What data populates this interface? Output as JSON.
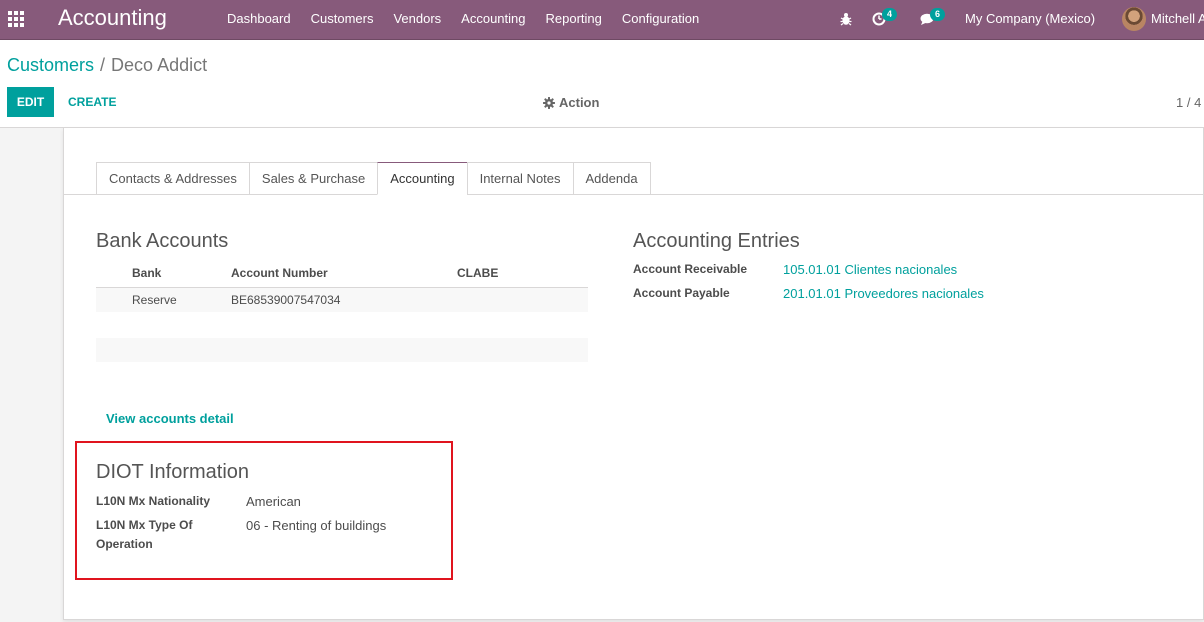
{
  "navbar": {
    "app_title": "Accounting",
    "menu": [
      "Dashboard",
      "Customers",
      "Vendors",
      "Accounting",
      "Reporting",
      "Configuration"
    ],
    "activity_count": "4",
    "message_count": "6",
    "company": "My Company (Mexico)",
    "user": "Mitchell Admin",
    "icons": [
      "apps-icon",
      "bug-icon",
      "clock-icon",
      "chat-icon",
      "avatar"
    ]
  },
  "control_panel": {
    "breadcrumb_parent": "Customers",
    "breadcrumb_separator": "/",
    "breadcrumb_current": "Deco Addict",
    "edit_label": "EDIT",
    "create_label": "CREATE",
    "action_label": "Action",
    "pager": "1 / 4"
  },
  "tabs": [
    "Contacts & Addresses",
    "Sales & Purchase",
    "Accounting",
    "Internal Notes",
    "Addenda"
  ],
  "active_tab": "Accounting",
  "bank_accounts": {
    "title": "Bank Accounts",
    "columns": [
      "Bank",
      "Account Number",
      "CLABE"
    ],
    "rows": [
      {
        "bank": "Reserve",
        "account_number": "BE68539007547034",
        "clabe": ""
      }
    ],
    "view_details": "View accounts detail"
  },
  "accounting_entries": {
    "title": "Accounting Entries",
    "receivable_label": "Account Receivable",
    "receivable_value": "105.01.01 Clientes nacionales",
    "payable_label": "Account Payable",
    "payable_value": "201.01.01 Proveedores nacionales"
  },
  "diot": {
    "title": "DIOT Information",
    "nationality_label": "L10N Mx Nationality",
    "nationality_value": "American",
    "operation_label_line1": "L10N Mx Type Of",
    "operation_label_line2": "Operation",
    "operation_value": "06 - Renting of buildings",
    "highlight_color": "#e0141e"
  },
  "colors": {
    "navbar": "#875A7B",
    "accent": "#00A09D"
  }
}
